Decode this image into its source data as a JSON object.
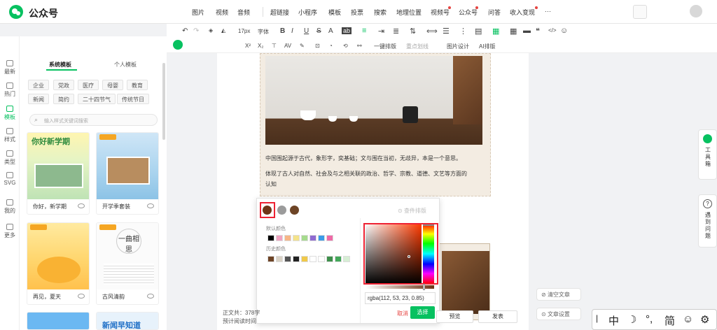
{
  "brand": {
    "name": "公众号"
  },
  "top_menu": [
    "图片",
    "视频",
    "音频",
    "超链接",
    "小程序",
    "模板",
    "投票",
    "搜索",
    "地理位置",
    "视频号",
    "公众号",
    "问答",
    "收入变现",
    "···"
  ],
  "toolbar": {
    "font_size": "17px",
    "font_label": "字体",
    "one_click": "一键排版",
    "font_size_label": "重点划线",
    "image_design": "图片设计",
    "ai": "AI排版"
  },
  "left_tabs": [
    "排版",
    "写作",
    "配图",
    "热榜",
    "工具"
  ],
  "rail": [
    "最新",
    "热门",
    "模板",
    "样式",
    "类型",
    "SVG",
    "我的",
    "更多"
  ],
  "panel": {
    "tab_system": "系统模板",
    "tab_personal": "个人模板",
    "chips_row1": [
      "企业",
      "党政",
      "医疗",
      "母婴",
      "教育"
    ],
    "chips_row2": [
      "新闻",
      "简约",
      "二十四节气",
      "传统节日"
    ],
    "search_placeholder": "输入样式关键词搜索",
    "cards": [
      "你好，新学期",
      "开学季套装",
      "再见，夏天",
      "古风清韵"
    ],
    "card_headings": [
      "你好新学期",
      "一曲相思",
      "新闻早知道"
    ]
  },
  "article": {
    "p1": "中国围起源于古代，象形字，奕基础；文与围在当初，无歧异，本是一个意思。",
    "p2": "体现了古人对自然、社会及与之相关联的政治、哲学、宗教、道德、文艺等方面的",
    "p3": "认知"
  },
  "picker": {
    "preset_label": "默认颜色",
    "history_label": "历史颜色",
    "top_right": "查件排版",
    "value": "rgba(112, 53, 23, 0.85)",
    "cancel": "取消",
    "confirm": "选择",
    "colors": {
      "selected": "#703517",
      "gray": "#9b9b9b",
      "brown": "#6d4426"
    }
  },
  "bottom": {
    "word_count": "正文共：378字",
    "read_time": "预计阅读时间：1",
    "preview": "预览",
    "publish": "发表",
    "clear": "清空文章",
    "settings": "文章设置"
  },
  "side": {
    "toolbox": "工具箱",
    "help": "遇到问题"
  },
  "ime": [
    "中",
    "☽",
    "°,",
    "简",
    "☺",
    "⚙"
  ]
}
